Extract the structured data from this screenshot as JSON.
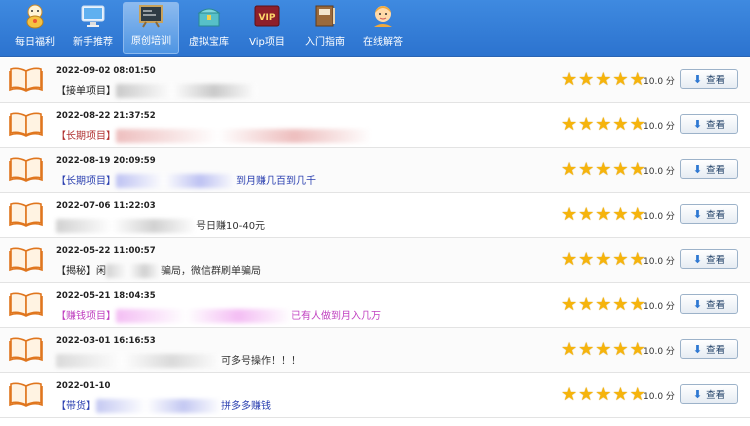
{
  "nav": [
    {
      "label": "每日福利",
      "icon": "lucky-cat-icon",
      "active": false
    },
    {
      "label": "新手推荐",
      "icon": "monitor-icon",
      "active": false
    },
    {
      "label": "原创培训",
      "icon": "training-board-icon",
      "active": true
    },
    {
      "label": "虚拟宝库",
      "icon": "treasure-box-icon",
      "active": false
    },
    {
      "label": "Vip项目",
      "icon": "vip-icon",
      "active": false
    },
    {
      "label": "入门指南",
      "icon": "guide-book-icon",
      "active": false
    },
    {
      "label": "在线解答",
      "icon": "support-agent-icon",
      "active": false
    }
  ],
  "view_label": "查看",
  "unit": "分",
  "items": [
    {
      "date": "2022-09-02 08:01:50",
      "tag": "【接单项目】",
      "tag_color": "#222222",
      "text": "",
      "text_color": "#333333",
      "blur_width": 140,
      "blur_color": "#b9b9b9",
      "rating": 5,
      "score": "10.0"
    },
    {
      "date": "2022-08-22 21:37:52",
      "tag": "【长期项目】",
      "tag_color": "#b03030",
      "text": "",
      "text_color": "#b03030",
      "blur_width": 255,
      "blur_color": "#e8a9a9",
      "rating": 5,
      "score": "10.0"
    },
    {
      "date": "2022-08-19 20:09:59",
      "tag": "【长期项目】",
      "tag_color": "#2a3fb0",
      "text": "到月赚几百到几千",
      "text_color": "#2a3fb0",
      "blur_width": 120,
      "blur_color": "#a9aff0",
      "rating": 5,
      "score": "10.0"
    },
    {
      "date": "2022-07-06 11:22:03",
      "tag": "",
      "tag_color": "#222222",
      "text": "号日赚10-40元",
      "text_color": "#333333",
      "blur_width": 140,
      "blur_color": "#c2c2c2",
      "rating": 5,
      "score": "10.0"
    },
    {
      "date": "2022-05-22 11:00:57",
      "tag": "【揭秘】闲",
      "tag_color": "#222222",
      "text": "骗局，微信群刷单骗局",
      "text_color": "#333333",
      "blur_width": 55,
      "blur_color": "#c2c2c2",
      "rating": 5,
      "score": "10.0"
    },
    {
      "date": "2022-05-21 18:04:35",
      "tag": "【赚钱项目】",
      "tag_color": "#c040c0",
      "text": "已有人做到月入几万",
      "text_color": "#c040c0",
      "blur_width": 175,
      "blur_color": "#f0a8f0",
      "rating": 5,
      "score": "10.0"
    },
    {
      "date": "2022-03-01 16:16:53",
      "tag": "",
      "tag_color": "#222222",
      "text": "可多号操作！！！",
      "text_color": "#333333",
      "blur_width": 165,
      "blur_color": "#cfcfcf",
      "rating": 5,
      "score": "10.0"
    },
    {
      "date": "2022-01-10",
      "tag": "【带货】",
      "tag_color": "#2a3fb0",
      "text": "拼多多赚钱",
      "text_color": "#2a3fb0",
      "blur_width": 125,
      "blur_color": "#b0b6ee",
      "rating": 5,
      "score": "10.0"
    }
  ]
}
